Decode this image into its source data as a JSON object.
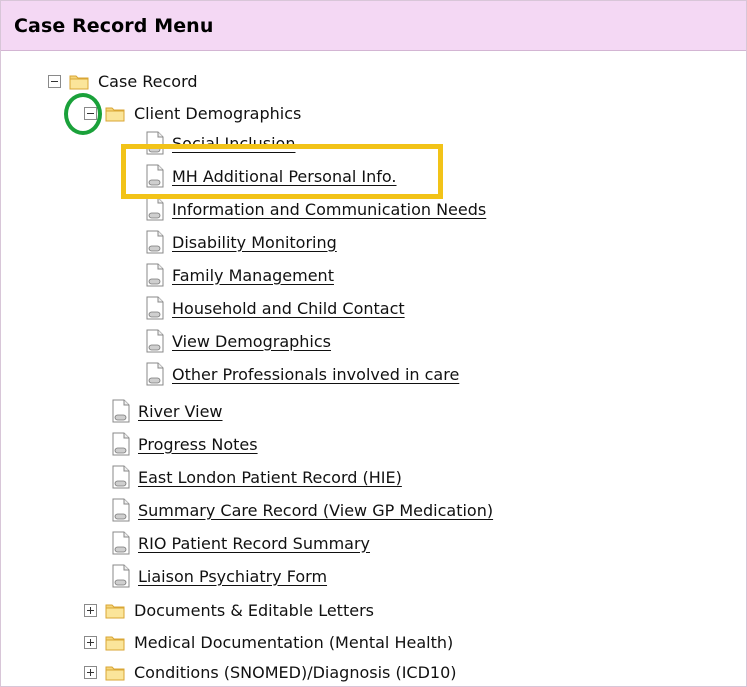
{
  "header": {
    "title": "Case Record Menu"
  },
  "tree": {
    "root": {
      "label": "Case Record",
      "expanded": true
    },
    "client_demographics": {
      "label": "Client Demographics",
      "expanded": true,
      "items": [
        "Social Inclusion",
        "MH Additional Personal Info.",
        "Information and Communication Needs",
        "Disability Monitoring",
        "Family Management",
        "Household and Child Contact",
        "View Demographics",
        "Other Professionals involved in care"
      ]
    },
    "links": [
      "River View",
      "Progress Notes",
      "East London Patient Record (HIE)",
      "Summary Care Record (View GP Medication)",
      "RIO Patient Record Summary",
      "Liaison Psychiatry Form"
    ],
    "collapsed_folders": [
      "Documents & Editable Letters",
      "Medical Documentation (Mental Health)",
      "Conditions (SNOMED)/Diagnosis (ICD10)"
    ]
  },
  "colors": {
    "header_bg": "#f4d8f4",
    "highlight_green": "#1aa13a",
    "highlight_yellow": "#f2c318"
  },
  "icons": {
    "folder": "folder-icon",
    "document": "document-link-icon",
    "expand": "plus-box-icon",
    "collapse": "minus-box-icon"
  }
}
